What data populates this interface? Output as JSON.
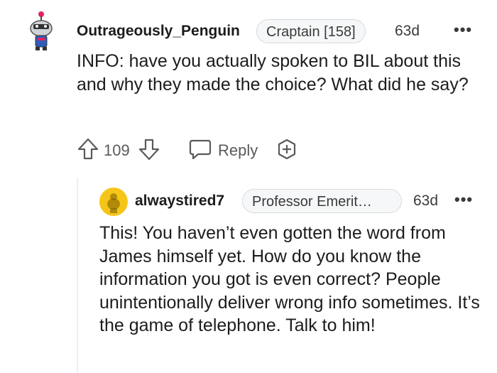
{
  "comments": [
    {
      "username": "Outrageously_Penguin",
      "flair": "Craptain [158]",
      "age": "63d",
      "more_label": "•••",
      "body": "INFO: have you actually spoken to BIL about this and why they made the choice? What did he say?",
      "votes": "109",
      "reply_label": "Reply",
      "icons": {
        "avatar": "snoo-penguin-avatar",
        "upvote": "arrow-up-icon",
        "downvote": "arrow-down-icon",
        "reply": "speech-bubble-icon",
        "award": "award-plus-icon"
      }
    },
    {
      "username": "alwaystired7",
      "flair": "Professor Emerit…",
      "age": "63d",
      "more_label": "•••",
      "body": "This! You haven’t even gotten the word from James himself yet. How do you know the information you got is even correct? People unintentionally deliver wrong info sometimes. It’s the game of telephone. Talk to him!",
      "icons": {
        "avatar": "snoo-yellow-avatar"
      }
    }
  ],
  "colors": {
    "text": "#1c1c1c",
    "meta": "#5a5a5a",
    "flair_bg": "#f6f7f8",
    "avatar_yellow": "#f5c518",
    "thread_line": "#edeff1"
  }
}
